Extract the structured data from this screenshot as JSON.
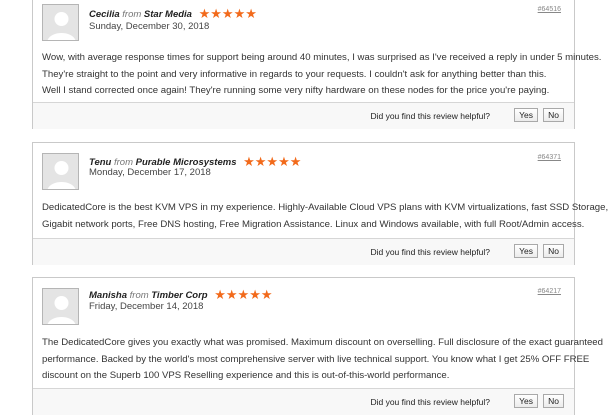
{
  "helpful_question": "Did you find this review helpful?",
  "yes_label": "Yes",
  "no_label": "No",
  "star_color": "#f26a1b",
  "reviews": [
    {
      "name": "Cecilia",
      "from": "from",
      "company": "Star Media",
      "stars": "★★★★★",
      "rating": 5,
      "date": "Sunday, December 30, 2018",
      "id": "#64516",
      "lines": [
        "Wow, with average response times for support being around 40 minutes, I was surprised as I've received a reply in under 5 minutes.",
        "They're straight to the point and very informative in regards to your requests. I couldn't ask for anything better than this.",
        "Well I stand corrected once again! They're running some very nifty hardware on these nodes for the price you're paying."
      ]
    },
    {
      "name": "Tenu",
      "from": "from",
      "company": "Purable Microsystems",
      "stars": "★★★★★",
      "rating": 5,
      "date": "Monday, December 17, 2018",
      "id": "#64371",
      "lines": [
        "DedicatedCore is the best KVM VPS in my experience. Highly-Available Cloud VPS plans with KVM virtualizations, fast SSD Storage,",
        "Gigabit network ports, Free DNS hosting, Free Migration Assistance. Linux and Windows available, with full Root/Admin access."
      ]
    },
    {
      "name": "Manisha",
      "from": "from",
      "company": "Timber Corp",
      "stars": "★★★★★",
      "rating": 5,
      "date": "Friday, December 14, 2018",
      "id": "#64217",
      "lines": [
        "The DedicatedCore gives you exactly what was promised. Maximum discount on overselling. Full disclosure of the exact guaranteed",
        "performance. Backed by the world's most comprehensive server with live technical support. You know what I get 25% OFF FREE",
        "discount on the Superb 100 VPS Reselling experience and this is out-of-this-world performance."
      ]
    }
  ]
}
